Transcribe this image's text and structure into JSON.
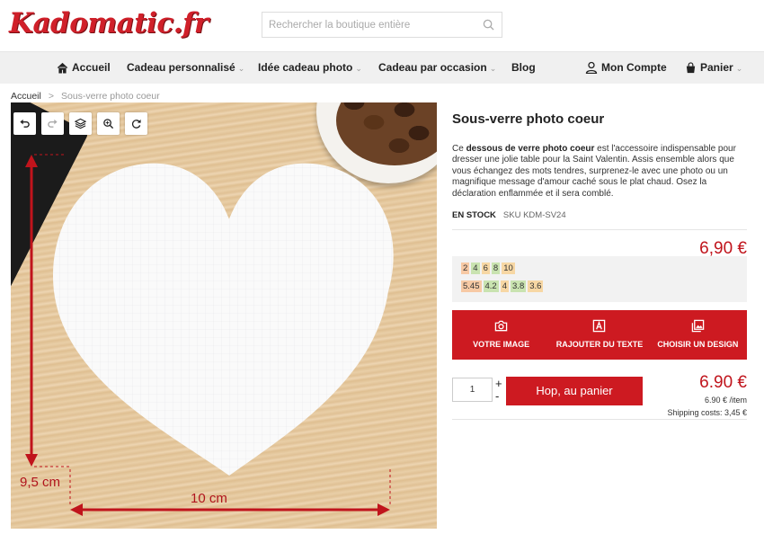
{
  "site": {
    "logo": "Kadomatic.fr"
  },
  "search": {
    "placeholder": "Rechercher la boutique entière",
    "icon": "search-icon"
  },
  "nav": {
    "home": "Accueil",
    "items": [
      {
        "label": "Cadeau personnalisé",
        "caret": "⌄"
      },
      {
        "label": "Idée cadeau photo",
        "caret": "⌄"
      },
      {
        "label": "Cadeau par occasion",
        "caret": "⌄"
      },
      {
        "label": "Blog",
        "caret": ""
      }
    ],
    "account": "Mon Compte",
    "cart": "Panier",
    "cart_caret": "⌄"
  },
  "breadcrumb": {
    "home": "Accueil",
    "separator": ">",
    "current": "Sous-verre photo coeur"
  },
  "designer": {
    "tools": [
      "undo-icon",
      "redo-icon",
      "layers-icon",
      "zoom-icon",
      "rotate-icon"
    ],
    "height_label": "9,5 cm",
    "width_label": "10 cm",
    "dimension_color": "#c0141c"
  },
  "product": {
    "title": "Sous-verre photo coeur",
    "desc_before": "Ce ",
    "desc_bold": "dessous de verre photo coeur",
    "desc_after": " est l'accessoire indispensable pour dresser une jolie table pour la Saint Valentin. Assis ensemble alors que vous échangez des mots tendres, surprenez-le avec une photo ou un magnifique message d'amour caché sous le plat chaud. Osez la déclaration enflammée et il sera comblé.",
    "stock": "EN STOCK",
    "sku": "SKU  KDM-SV24",
    "price": "6,90 €",
    "tiers": {
      "quantities": [
        "2",
        "4",
        "6",
        "8",
        "10"
      ],
      "prices": [
        "5.45",
        "4.2",
        "4",
        "3.8",
        "3.6"
      ]
    }
  },
  "actions": [
    {
      "label": "VOTRE IMAGE",
      "icon": "camera-icon"
    },
    {
      "label": "RAJOUTER DU TEXTE",
      "icon": "text-icon"
    },
    {
      "label": "CHOISIR UN DESIGN",
      "icon": "image-icon"
    }
  ],
  "purchase": {
    "quantity": "1",
    "plus": "+",
    "minus": "-",
    "add_to_cart": "Hop, au panier",
    "total": "6.90 €",
    "unit_price": "6.90 € /item",
    "shipping": "Shipping costs: 3,45 €"
  },
  "colors": {
    "brand": "#cd1a21",
    "price": "#c0141c"
  }
}
